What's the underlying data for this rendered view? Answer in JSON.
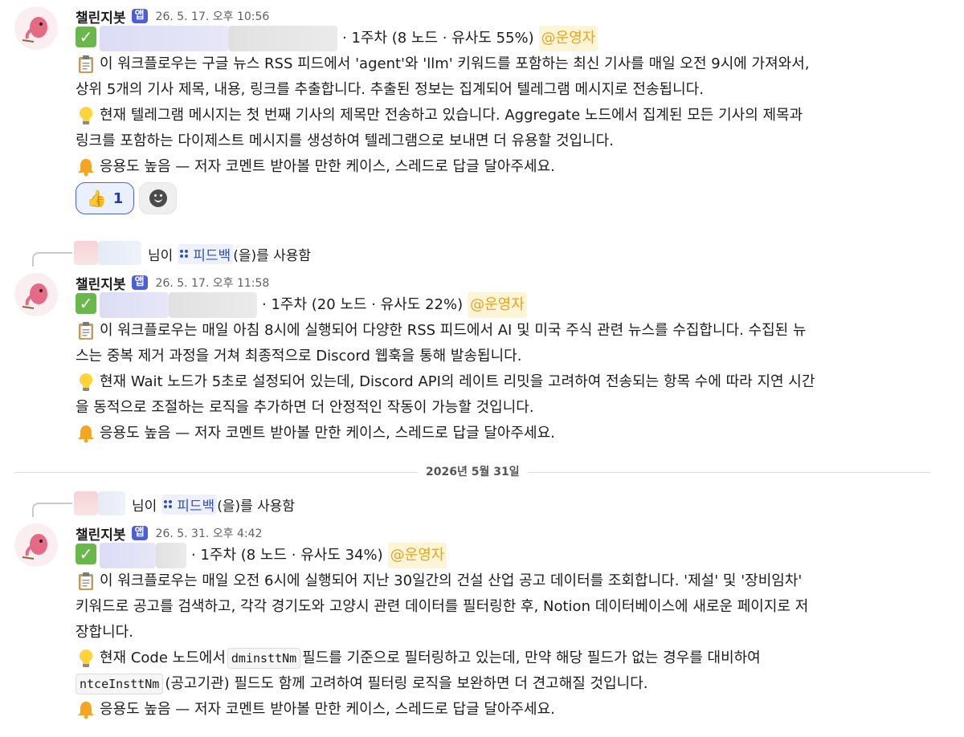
{
  "messages": [
    {
      "bot_name": "챌린지봇",
      "badge": "앱",
      "timestamp": "26. 5. 17. 오후 10:56",
      "check_emoji": "✅",
      "meta": "· 1주차 (8 노드 · 유사도 55%)",
      "mention": "@운영자",
      "summary_lines": [
        "이 워크플로우는 구글 뉴스 RSS 피드에서 'agent'와 'llm' 키워드를 포함하는 최신 기사를 매일 오전 9시에 가져와서,",
        "상위 5개의 기사 제목, 내용, 링크를 추출합니다. 추출된 정보는 집계되어 텔레그램 메시지로 전송됩니다."
      ],
      "tip_lines": [
        "현재 텔레그램 메시지는 첫 번째 기사의 제목만 전송하고 있습니다. Aggregate 노드에서 집계된 모든 기사의 제목과",
        "링크를 포함하는 다이제스트 메시지를 생성하여 텔레그램으로 보내면 더 유용할 것입니다."
      ],
      "alert": "응용도 높음 — 저자 코멘트 받아볼 만한 케이스, 스레드로 답글 달아주세요.",
      "reaction": {
        "emoji": "👍",
        "count": "1"
      }
    },
    {
      "thread_context": {
        "suffix": "님이",
        "workflow": "피드백",
        "tail": "(을)를 사용함"
      },
      "bot_name": "챌린지봇",
      "badge": "앱",
      "timestamp": "26. 5. 17. 오후 11:58",
      "check_emoji": "✅",
      "meta": "· 1주차 (20 노드 · 유사도 22%)",
      "mention": "@운영자",
      "summary_lines": [
        "이 워크플로우는 매일 아침 8시에 실행되어 다양한 RSS 피드에서 AI 및 미국 주식 관련 뉴스를 수집합니다. 수집된 뉴",
        "스는 중복 제거 과정을 거쳐 최종적으로 Discord 웹훅을 통해 발송됩니다."
      ],
      "tip_lines": [
        "현재 Wait 노드가 5초로 설정되어 있는데, Discord API의 레이트 리밋을 고려하여 전송되는 항목 수에 따라 지연 시간",
        "을 동적으로 조절하는 로직을 추가하면 더 안정적인 작동이 가능할 것입니다."
      ],
      "alert": "응용도 높음 — 저자 코멘트 받아볼 만한 케이스, 스레드로 답글 달아주세요."
    },
    {
      "thread_context": {
        "suffix": "님이",
        "workflow": "피드백",
        "tail": "(을)를 사용함"
      },
      "bot_name": "챌린지봇",
      "badge": "앱",
      "timestamp": "26. 5. 31. 오후 4:42",
      "check_emoji": "✅",
      "meta": "· 1주차 (8 노드 · 유사도 34%)",
      "mention": "@운영자",
      "summary_lines": [
        "이 워크플로우는 매일 오전 6시에 실행되어 지난 30일간의 건설 산업 공고 데이터를 조회합니다. '제설' 및 '장비임차'",
        "키워드로 공고를 검색하고, 각각 경기도와 고양시 관련 데이터를 필터링한 후, Notion 데이터베이스에 새로운 페이지로 저",
        "장합니다."
      ],
      "tip": {
        "line1_before": "현재 Code 노드에서",
        "code1": "dminsttNm",
        "line1_after": "필드를 기준으로 필터링하고 있는데, 만약 해당 필드가 없는 경우를 대비하여",
        "code2": "ntceInsttNm",
        "line2_after": "(공고기관) 필드도 함께 고려하여 필터링 로직을 보완하면 더 견고해질 것입니다."
      },
      "alert": "응용도 높음 — 저자 코멘트 받아볼 만한 케이스, 스레드로 답글 달아주세요."
    }
  ],
  "date_divider": "2026년 5월 31일"
}
